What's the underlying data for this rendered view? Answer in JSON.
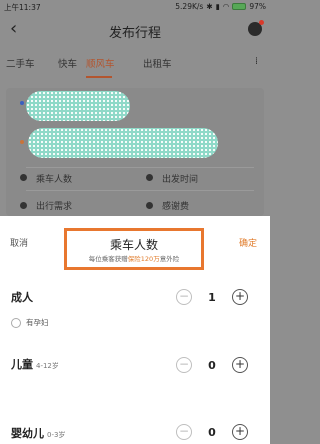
{
  "status_bar": {
    "time": "上午11:37",
    "network": "5.29K/s",
    "battery_percent": "97%"
  },
  "header": {
    "title": "发布行程"
  },
  "tabs": [
    {
      "label": "二手车",
      "active": false
    },
    {
      "label": "快车",
      "active": false
    },
    {
      "label": "顺风车",
      "active": true
    },
    {
      "label": "出租车",
      "active": false
    }
  ],
  "form": {
    "passenger_label": "乘车人数",
    "depart_time_label": "出发时间",
    "trip_option_label": "出行需求",
    "thanks_fee_label": "感谢费"
  },
  "sheet": {
    "cancel": "取消",
    "confirm": "确定",
    "title": "乘车人数",
    "subtitle_pre": "每位乘客获赠",
    "subtitle_highlight": "保险120万",
    "subtitle_post": "意外险",
    "options": [
      {
        "name": "成人",
        "sub": "",
        "count": "1"
      },
      {
        "name": "儿童",
        "sub": "4-12岁",
        "count": "0"
      },
      {
        "name": "婴幼儿",
        "sub": "0-3岁",
        "count": "0"
      }
    ],
    "pregnant_label": "有孕妇"
  },
  "colors": {
    "accent": "#e07b2a",
    "highlight_box": "#e8772f"
  }
}
